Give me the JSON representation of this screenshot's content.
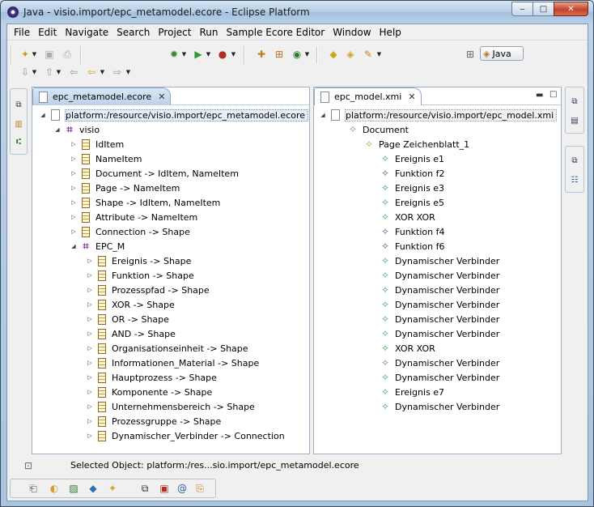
{
  "window": {
    "title": "Java - visio.import/epc_metamodel.ecore - Eclipse Platform",
    "buttons": {
      "minimize": "‒",
      "maximize": "□",
      "close": "✕"
    }
  },
  "menu": [
    {
      "label": "File"
    },
    {
      "label": "Edit"
    },
    {
      "label": "Navigate"
    },
    {
      "label": "Search"
    },
    {
      "label": "Project"
    },
    {
      "label": "Run"
    },
    {
      "label": "Sample Ecore Editor"
    },
    {
      "label": "Window"
    },
    {
      "label": "Help"
    }
  ],
  "perspective": {
    "label": "Java"
  },
  "left_editor": {
    "tab_label": "epc_metamodel.ecore",
    "root": "platform:/resource/visio.import/epc_metamodel.ecore",
    "package": "visio",
    "classes": [
      "IdItem",
      "NameItem",
      "Document -> IdItem, NameItem",
      "Page -> NameItem",
      "Shape -> IdItem, NameItem",
      "Attribute -> NameItem",
      "Connection -> Shape"
    ],
    "subpackage": "EPC_M",
    "subclasses": [
      "Ereignis -> Shape",
      "Funktion -> Shape",
      "Prozesspfad -> Shape",
      "XOR -> Shape",
      "OR -> Shape",
      "AND -> Shape",
      "Organisationseinheit -> Shape",
      "Informationen_Material -> Shape",
      "Hauptprozess -> Shape",
      "Komponente -> Shape",
      "Unternehmensbereich -> Shape",
      "Prozessgruppe -> Shape",
      "Dynamischer_Verbinder -> Connection"
    ]
  },
  "right_editor": {
    "tab_label": "epc_model.xmi",
    "root": "platform:/resource/visio.import/epc_model.xmi",
    "document": "Document",
    "page": "Page Zeichenblatt_1",
    "items": [
      "Ereignis e1",
      "Funktion f2",
      "Ereignis e3",
      "Ereignis e5",
      "XOR XOR",
      "Funktion f4",
      "Funktion f6",
      "Dynamischer Verbinder",
      "Dynamischer Verbinder",
      "Dynamischer Verbinder",
      "Dynamischer Verbinder",
      "Dynamischer Verbinder",
      "Dynamischer Verbinder",
      "XOR XOR",
      "Dynamischer Verbinder",
      "Dynamischer Verbinder",
      "Ereignis e7",
      "Dynamischer Verbinder"
    ]
  },
  "status": {
    "text": "Selected Object: platform:/res...sio.import/epc_metamodel.ecore"
  },
  "colors": {
    "accent": "#3b6db3",
    "selection": "#e6eef8"
  }
}
